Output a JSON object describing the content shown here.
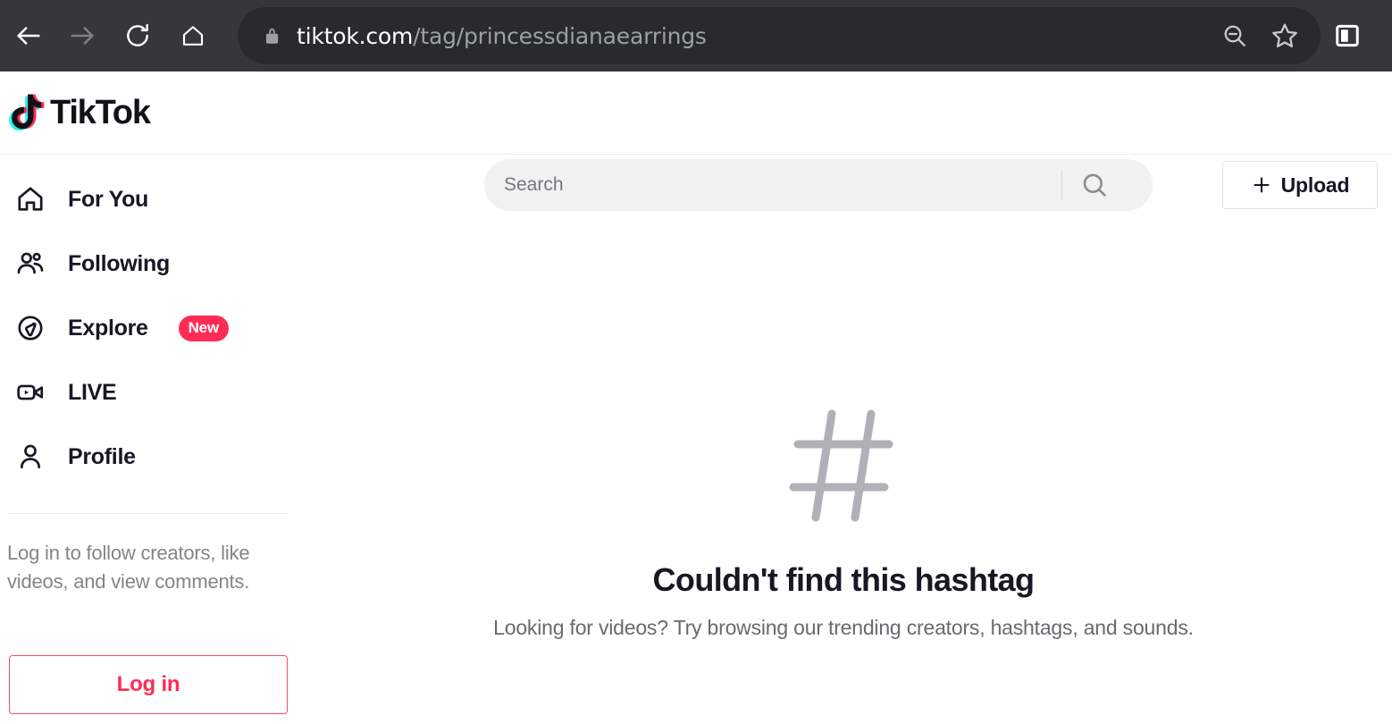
{
  "browser": {
    "back_icon": "arrow-left-icon",
    "forward_icon": "arrow-right-icon",
    "reload_icon": "reload-icon",
    "home_icon": "home-icon",
    "lock_icon": "lock-icon",
    "url_host": "tiktok.com",
    "url_path": "/tag/princessdianaearrings",
    "zoom_out_icon": "zoom-out-icon",
    "bookmark_icon": "star-icon",
    "side_panel_icon": "side-panel-icon"
  },
  "header": {
    "logo_text": "TikTok",
    "search": {
      "value": "",
      "placeholder": "Search",
      "icon": "search-icon"
    },
    "upload": {
      "label": "Upload",
      "icon": "plus-icon"
    }
  },
  "sidebar": {
    "items": [
      {
        "label": "For You",
        "icon": "home-icon"
      },
      {
        "label": "Following",
        "icon": "people-icon"
      },
      {
        "label": "Explore",
        "icon": "compass-icon",
        "badge": "New"
      },
      {
        "label": "LIVE",
        "icon": "live-video-icon"
      },
      {
        "label": "Profile",
        "icon": "person-icon"
      }
    ],
    "login_prompt": "Log in to follow creators, like videos, and view comments.",
    "login_button": "Log in"
  },
  "main": {
    "empty_icon": "hashtag-icon",
    "title": "Couldn't find this hashtag",
    "subtitle": "Looking for videos? Try browsing our trending creators, hashtags, and sounds."
  },
  "colors": {
    "accent_pink": "#FE2C55",
    "accent_cyan": "#25F4EE",
    "text_primary": "#161823",
    "text_secondary": "#848489",
    "chrome_bg": "#35373B",
    "omnibox_bg": "#272A2E"
  }
}
